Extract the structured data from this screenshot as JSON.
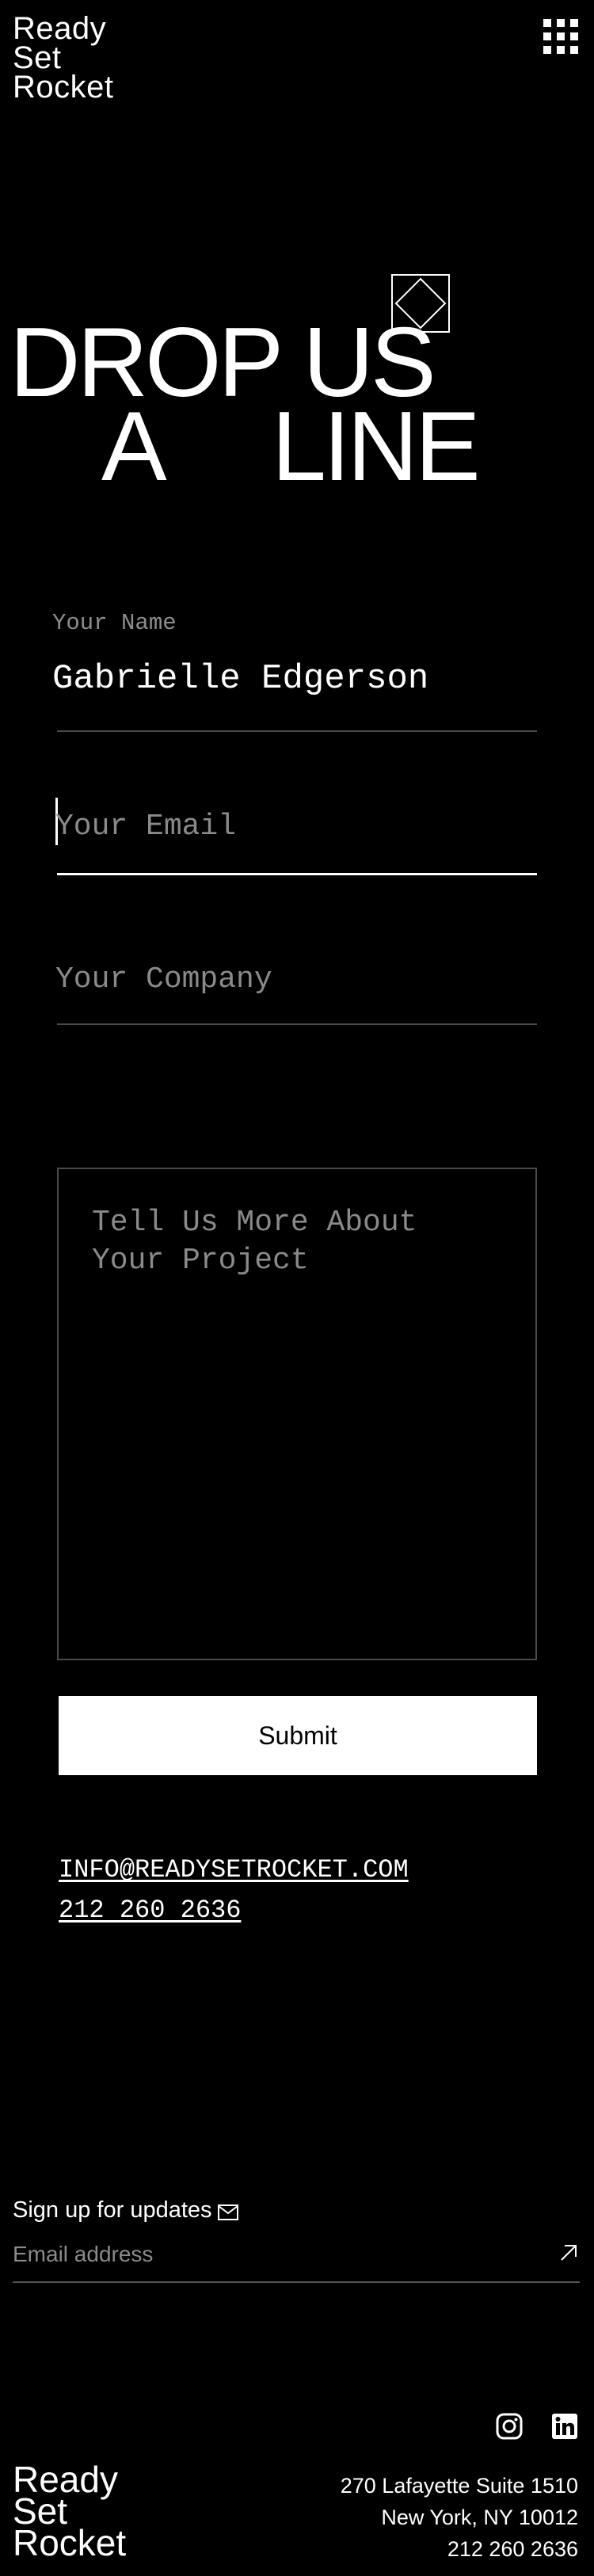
{
  "header": {
    "logo_lines": [
      "Ready",
      "Set",
      "Rocket"
    ],
    "menu_icon": "grid-menu-icon"
  },
  "hero": {
    "heading_line1": "DROP US",
    "heading_line2_left": "A",
    "heading_line2_right": "LINE",
    "decoration_icon": "diamond-in-square-icon"
  },
  "form": {
    "name": {
      "label": "Your Name",
      "value": "Gabrielle Edgerson"
    },
    "email": {
      "placeholder": "Your Email"
    },
    "company": {
      "placeholder": "Your Company"
    },
    "message": {
      "placeholder": "Tell Us More About Your Project"
    },
    "submit_label": "Submit"
  },
  "contact": {
    "email": "INFO@READYSETROCKET.COM",
    "phone": "212 260 2636"
  },
  "signup": {
    "label": "Sign up for updates",
    "placeholder": "Email address",
    "label_icon": "mail-icon",
    "submit_icon": "arrow-up-right-icon"
  },
  "footer": {
    "social_icons": [
      "instagram-icon",
      "linkedin-icon"
    ],
    "logo_lines": [
      "Ready",
      "Set",
      "Rocket"
    ],
    "address_line1": "270 Lafayette Suite 1510",
    "address_line2": "New York, NY 10012",
    "phone": "212 260 2636"
  }
}
